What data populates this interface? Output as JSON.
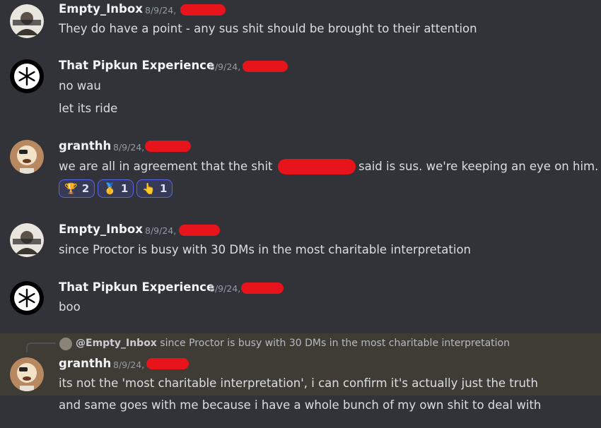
{
  "messages": [
    {
      "author": "Empty_Inbox",
      "timestamp": "8/9/24,",
      "lines": [
        "They do have a point - any sus shit should be brought to their attention"
      ]
    },
    {
      "author": "That Pipkun Experience",
      "timestamp": "8/9/24,",
      "lines": [
        "no wau",
        "let its ride"
      ]
    },
    {
      "author": "granthh",
      "timestamp": "8/9/24,",
      "lines": [
        "we are all in agreement that the shit",
        "said is sus. we're keeping an eye on him."
      ],
      "reactions": [
        {
          "emoji": "🏆",
          "count": "2",
          "icon": "trophy-icon"
        },
        {
          "emoji": "🥇",
          "count": "1",
          "icon": "first-place-medal-icon"
        },
        {
          "emoji": "👆",
          "count": "1",
          "icon": "pointing-up-icon"
        }
      ]
    },
    {
      "author": "Empty_Inbox",
      "timestamp": "8/9/24,",
      "lines": [
        "since Proctor is busy with 30 DMs in the most charitable interpretation"
      ]
    },
    {
      "author": "That Pipkun Experience",
      "timestamp": "8/9/24,",
      "lines": [
        "boo"
      ]
    },
    {
      "author": "granthh",
      "timestamp": "8/9/24,",
      "reply": {
        "author": "@Empty_Inbox",
        "text": "since Proctor is busy with 30 DMs in the most charitable interpretation"
      },
      "lines": [
        "its not the 'most charitable interpretation', i can confirm it's actually just the truth",
        "and same goes with me because i have a whole bunch of my own shit to deal with"
      ]
    }
  ],
  "colors": {
    "background": "#313338",
    "highlight": "#3f3c36",
    "redaction": "#e8141b",
    "reaction_border": "#5865f2"
  }
}
